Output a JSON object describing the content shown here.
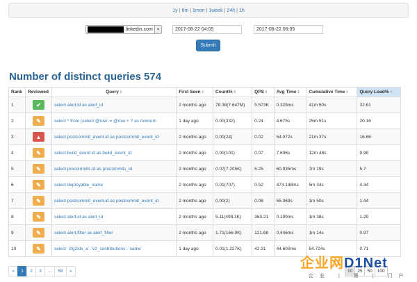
{
  "range_links": [
    "1y",
    "6m",
    "1mon",
    "1week",
    "24h",
    "1h"
  ],
  "filter": {
    "host_suffix": ".linkedin.com",
    "from": "2017-08-22 04:05",
    "to": "2017-08-22 06:05",
    "submit_label": "Submit"
  },
  "heading": {
    "label": "Number of distinct queries",
    "count": "574"
  },
  "columns": [
    "Rank",
    "Reviewed",
    "Query",
    "First Seen",
    "Count%",
    "QPS",
    "Avg Time",
    "Cumulative Time",
    "Query Load%"
  ],
  "rows": [
    {
      "rank": "1",
      "status": "ok",
      "query": "select alert.id as alert_id",
      "first_seen": "2 months ago",
      "count": "78.38(7.647M)",
      "qps": "5.573K",
      "avg": "0.328ms",
      "cum": "41m 50s",
      "load": "32.61"
    },
    {
      "rank": "2",
      "status": "edit",
      "query": "select * from (select @row := @row + ? as rownum",
      "first_seen": "1 day ago",
      "count": "0.00(332)",
      "qps": "0.24",
      "avg": "4.675s",
      "cum": "25m 51s",
      "load": "20.16"
    },
    {
      "rank": "3",
      "status": "warn",
      "query": "select postcommit_event.id as postcommit_event_id",
      "first_seen": "2 months ago",
      "count": "0.00(24)",
      "qps": "0.02",
      "avg": "54.072s",
      "cum": "21m 37s",
      "load": "16.86"
    },
    {
      "rank": "4",
      "status": "edit",
      "query": "select build_event.id as build_event_id",
      "first_seen": "2 months ago",
      "count": "0.00(101)",
      "qps": "0.07",
      "avg": "7.606s",
      "cum": "12m 48s",
      "load": "9.98"
    },
    {
      "rank": "5",
      "status": "edit",
      "query": "select precommits.id as precommits_id",
      "first_seen": "2 months ago",
      "count": "0.07(7.205K)",
      "qps": "5.25",
      "avg": "60.935ms",
      "cum": "7m 19s",
      "load": "5.7"
    },
    {
      "rank": "6",
      "status": "edit",
      "query": "select deployable_name",
      "first_seen": "2 months ago",
      "count": "0.01(707)",
      "qps": "0.52",
      "avg": "473.148ms",
      "cum": "5m 34s",
      "load": "4.34"
    },
    {
      "rank": "7",
      "status": "edit",
      "query": "select postcommit_event.id as postcommit_event_id",
      "first_seen": "2 months ago",
      "count": "0.00(2)",
      "qps": "0.08",
      "avg": "55.369s",
      "cum": "1m 50s",
      "load": "1.44"
    },
    {
      "rank": "8",
      "status": "edit",
      "query": "select alert.id as alert_id",
      "first_seen": "2 months ago",
      "count": "5.11(498.3K)",
      "qps": "363.21",
      "avg": "0.199ms",
      "cum": "1m 38s",
      "load": "1.29"
    },
    {
      "rank": "9",
      "status": "edit",
      "query": "select alert.filter as alert_filter",
      "first_seen": "2 months ago",
      "count": "1.71(166.9K)",
      "qps": "121.68",
      "avg": "0.446ms",
      "cum": "1m 14s",
      "load": "0.97"
    },
    {
      "rank": "10",
      "status": "edit",
      "query": "select `cfg2idx_a`.`v2_contributions`.`name`",
      "first_seen": "1 day ago",
      "count": "0.01(1.227K)",
      "qps": "42.31",
      "avg": "44.600ms",
      "cum": "54.724s",
      "load": "0.71"
    }
  ],
  "status_icons": {
    "ok": "check-icon",
    "edit": "pencil-icon",
    "warn": "warning-icon"
  },
  "status_glyphs": {
    "ok": "✔",
    "edit": "✎",
    "warn": "▲"
  },
  "pagination": [
    "«",
    "1",
    "2",
    "3",
    "...",
    "58",
    "»"
  ],
  "pagination_active": "1",
  "per_page": [
    "10",
    "25",
    "50",
    "100"
  ],
  "per_page_active": "10",
  "watermark": {
    "brand_cn": "企业网",
    "brand_en": "D1Net",
    "sub": "企业 | 第 | 门户"
  },
  "colors": {
    "primary": "#337ab7",
    "success": "#5cb85c",
    "warning": "#f0ad4e",
    "danger": "#d9534f"
  }
}
